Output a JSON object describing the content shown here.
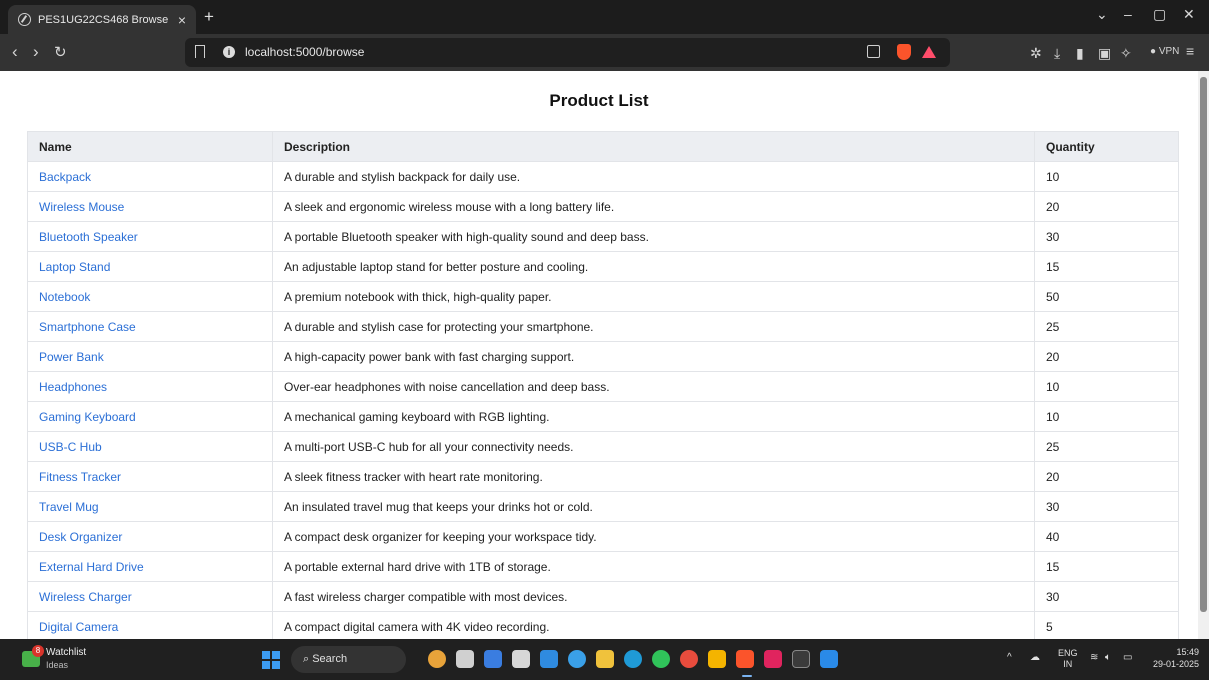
{
  "browser": {
    "tab_title": "PES1UG22CS468 Browse",
    "tab_close": "×",
    "new_tab": "+",
    "url": "localhost:5000/browse",
    "vpn_label": "VPN"
  },
  "page": {
    "title": "Product List",
    "columns": [
      "Name",
      "Description",
      "Quantity"
    ],
    "rows": [
      {
        "name": "Backpack",
        "description": "A durable and stylish backpack for daily use.",
        "quantity": "10"
      },
      {
        "name": "Wireless Mouse",
        "description": "A sleek and ergonomic wireless mouse with a long battery life.",
        "quantity": "20"
      },
      {
        "name": "Bluetooth Speaker",
        "description": "A portable Bluetooth speaker with high-quality sound and deep bass.",
        "quantity": "30"
      },
      {
        "name": "Laptop Stand",
        "description": "An adjustable laptop stand for better posture and cooling.",
        "quantity": "15"
      },
      {
        "name": "Notebook",
        "description": "A premium notebook with thick, high-quality paper.",
        "quantity": "50"
      },
      {
        "name": "Smartphone Case",
        "description": "A durable and stylish case for protecting your smartphone.",
        "quantity": "25"
      },
      {
        "name": "Power Bank",
        "description": "A high-capacity power bank with fast charging support.",
        "quantity": "20"
      },
      {
        "name": "Headphones",
        "description": "Over-ear headphones with noise cancellation and deep bass.",
        "quantity": "10"
      },
      {
        "name": "Gaming Keyboard",
        "description": "A mechanical gaming keyboard with RGB lighting.",
        "quantity": "10"
      },
      {
        "name": "USB-C Hub",
        "description": "A multi-port USB-C hub for all your connectivity needs.",
        "quantity": "25"
      },
      {
        "name": "Fitness Tracker",
        "description": "A sleek fitness tracker with heart rate monitoring.",
        "quantity": "20"
      },
      {
        "name": "Travel Mug",
        "description": "An insulated travel mug that keeps your drinks hot or cold.",
        "quantity": "30"
      },
      {
        "name": "Desk Organizer",
        "description": "A compact desk organizer for keeping your workspace tidy.",
        "quantity": "40"
      },
      {
        "name": "External Hard Drive",
        "description": "A portable external hard drive with 1TB of storage.",
        "quantity": "15"
      },
      {
        "name": "Wireless Charger",
        "description": "A fast wireless charger compatible with most devices.",
        "quantity": "30"
      },
      {
        "name": "Digital Camera",
        "description": "A compact digital camera with 4K video recording.",
        "quantity": "5"
      }
    ],
    "link_color": "#2b6fd6"
  },
  "taskbar": {
    "weather_badge": "8",
    "weather_title": "Watchlist",
    "weather_subtitle": "Ideas",
    "search_label": "Search",
    "lang_line1": "ENG",
    "lang_line2": "IN",
    "time": "15:49",
    "date": "29-01-2025"
  }
}
